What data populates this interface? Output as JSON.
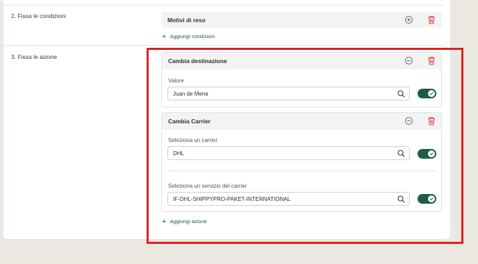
{
  "conditions_section": {
    "label": "2. Fissa le condizioni",
    "card_title": "Motivi di reso",
    "add_link": "Aggiungi condizioni"
  },
  "actions_section": {
    "label": "3. Fissa le azione",
    "cards": [
      {
        "title": "Cambia destinazione",
        "fields": [
          {
            "label": "Valore",
            "value": "Juan de Mena",
            "toggle_on": true
          }
        ]
      },
      {
        "title": "Cambia Carrier",
        "fields": [
          {
            "label": "Seleziona un carrier",
            "value": "DHL",
            "toggle_on": true
          },
          {
            "label": "Seleziona un servizio del carrier",
            "value": "IF-DHL-SHIPPYPRO-PAKET-INTERNATIONAL",
            "toggle_on": true
          }
        ]
      }
    ],
    "add_link": "Aggiungi azione"
  },
  "icons": {
    "add": "plus-circle-icon",
    "remove": "minus-circle-icon",
    "delete": "trash-icon",
    "search": "search-icon",
    "toggle_check": "check-icon"
  },
  "colors": {
    "accent_green": "#1c5e44",
    "delete_red": "#e0393e",
    "highlight_red": "#e01f1f",
    "background": "#ebe8e1"
  }
}
